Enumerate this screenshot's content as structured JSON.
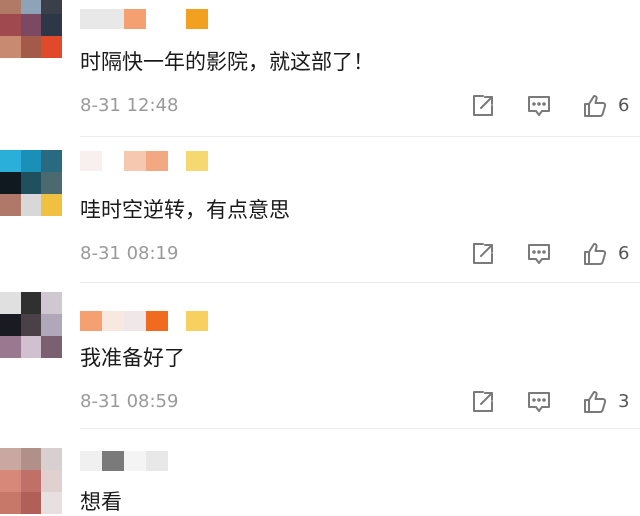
{
  "comments": [
    {
      "content": "时隔快一年的影院，就这部了！",
      "time": "8-31 12:48",
      "likes": "6",
      "avatar_colors": [
        "#b07a66",
        "#8fa3b8",
        "#3a3f4a",
        "#a04a50",
        "#7b4a62",
        "#2d3748",
        "#c98a72",
        "#a35a48",
        "#e04a2a"
      ],
      "username_colors": [
        "#e8e8e8",
        "#e8e8e8",
        "#f5a070",
        "#ffffff",
        "#f2a020"
      ]
    },
    {
      "content": "哇时空逆转，有点意思",
      "time": "8-31 08:19",
      "likes": "6",
      "avatar_colors": [
        "#2ab0d8",
        "#1a8fb8",
        "#2a6a80",
        "#101820",
        "#20505e",
        "#4a6a70",
        "#b07868",
        "#d8d8d8",
        "#f0c040"
      ],
      "username_colors": [
        "#f8f0ee",
        "#ffffff",
        "#f6c8b0",
        "#f2a880",
        "#f6d870"
      ]
    },
    {
      "content": "我准备好了",
      "time": "8-31 08:59",
      "likes": "3",
      "avatar_colors": [
        "#e0e0e0",
        "#303030",
        "#cfc8d0",
        "#1a1a22",
        "#4a4048",
        "#b0a8b8",
        "#9a7890",
        "#d0c0d0",
        "#7a6070"
      ],
      "username_colors": [
        "#f4a070",
        "#f8e8e0",
        "#f0e8e8",
        "#f06a20",
        "#f8d060"
      ]
    },
    {
      "content": "想看",
      "time": "",
      "likes": "",
      "avatar_colors": [
        "#c8a8a0",
        "#b09088",
        "#d8d0d0",
        "#d88878",
        "#c07068",
        "#e0d0d0",
        "#c87868",
        "#b06058",
        "#e8e0e0"
      ],
      "username_colors": [
        "#f0f0f0",
        "#7a7a7a",
        "#f4f4f4",
        "#e8e8e8",
        "#ffffff"
      ]
    }
  ],
  "icons": {
    "share": "share-icon",
    "comment": "comment-icon",
    "like": "like-icon"
  }
}
